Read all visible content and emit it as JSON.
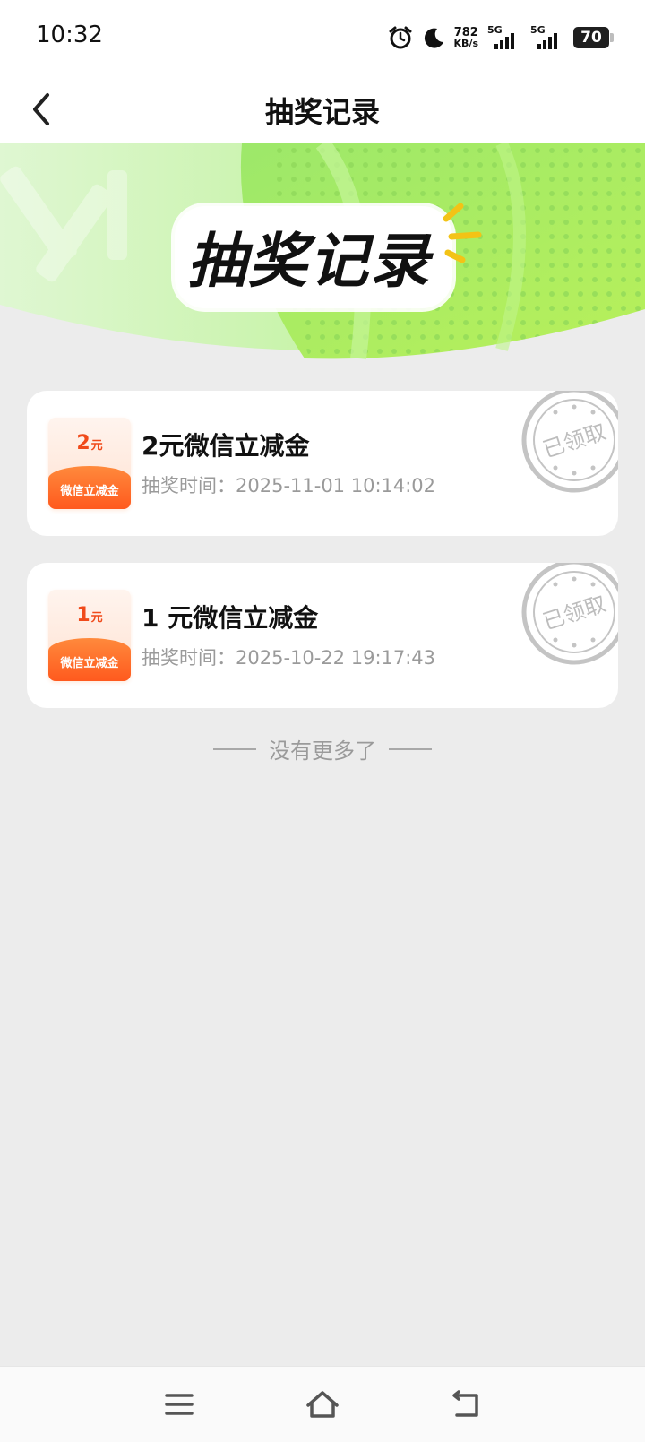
{
  "status_bar": {
    "time": "10:32",
    "net_speed_value": "782",
    "net_speed_unit": "KB/s",
    "sim1_label": "5G",
    "sim2_label": "5G",
    "battery": "70",
    "icons": [
      "alarm-icon",
      "moon-icon",
      "signal-icon",
      "signal-icon",
      "battery-icon"
    ]
  },
  "header": {
    "title": "抽奖记录"
  },
  "banner": {
    "title": "抽奖记录"
  },
  "records": [
    {
      "coupon_amount": "2",
      "coupon_unit": "元",
      "coupon_label": "微信立减金",
      "title": "2元微信立减金",
      "time": "抽奖时间：2025-11-01 10:14:02",
      "stamp": "已领取"
    },
    {
      "coupon_amount": "1",
      "coupon_unit": "元",
      "coupon_label": "微信立减金",
      "title": "1 元微信立减金",
      "time": "抽奖时间：2025-10-22 19:17:43",
      "stamp": "已领取"
    }
  ],
  "footer": {
    "no_more": "没有更多了"
  },
  "colors": {
    "accent_orange": "#ff5a1e",
    "banner_green": "#8fe35a",
    "page_bg": "#ececec"
  }
}
